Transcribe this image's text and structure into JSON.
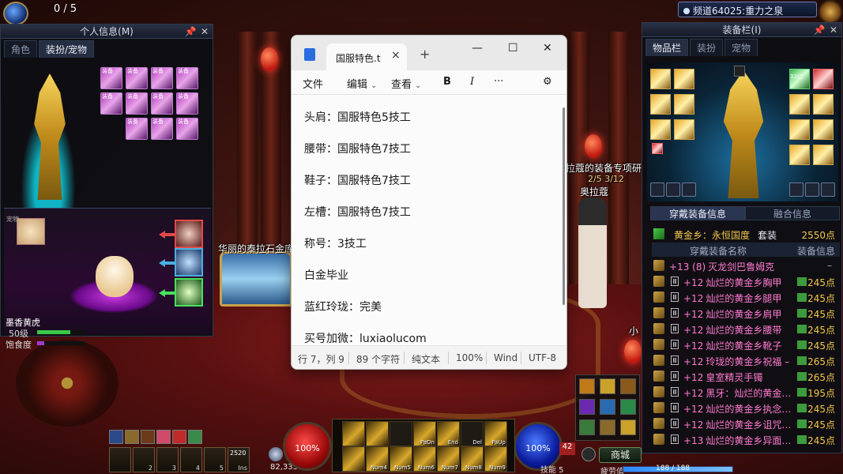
{
  "top_left": {
    "counter": "0 / 5"
  },
  "channel": {
    "label": "频道64025:重力之泉"
  },
  "scene": {
    "label_marble": "华丽的泰拉石金库",
    "label_shop": "拉蔻的装备专项研",
    "label_quest": "2/5 3/12",
    "label_npc": "奥拉蔻",
    "label_small": "小"
  },
  "left_panel": {
    "title": "个人信息(M)",
    "tabs": [
      "角色",
      "装扮/宠物"
    ],
    "slot_tag": "装备",
    "pet_thumb_label": "宠物",
    "pet_name": "墨香黄虎",
    "pet_level": "50级",
    "pet_satiety": "饱食度",
    "hp_fraction": 0.7,
    "sat_fraction": 0.15
  },
  "notepad": {
    "tab_title": "国服特色.t",
    "tab_close": "×",
    "new_tab": "+",
    "win_min": "—",
    "win_max": "☐",
    "win_close": "✕",
    "menu": {
      "file": "文件",
      "edit": "编辑",
      "view": "查看"
    },
    "lines": [
      "头肩：国服特色5技工",
      "腰带：国服特色7技工",
      "鞋子：国服特色7技工",
      "左槽：国服特色7技工",
      "称号：3技工",
      "白金毕业",
      "蓝红玲珑：完美",
      "买号加微：luxiaolucom"
    ],
    "status": {
      "position": "行 7，列 9",
      "chars": "89 个字符",
      "format": "纯文本",
      "zoom": "100%",
      "line_ending": "Wind",
      "encoding": "UTF-8"
    }
  },
  "right_panel": {
    "title": "装备栏(I)",
    "tabs": [
      "物品栏",
      "装扮",
      "宠物"
    ],
    "slot_badge": "33亿",
    "info_tabs": [
      "穿戴装备信息",
      "融合信息"
    ],
    "set_name": "黄金乡：永恒国度",
    "set_label": "套装",
    "set_points": "2550点",
    "col_name": "穿戴装备名称",
    "col_info": "装备信息",
    "col_info_dash": "–",
    "items": [
      {
        "plus": "+13 (8)",
        "name": "灭龙剑巴鲁姆克",
        "pts": "",
        "color": "#ff7ad0"
      },
      {
        "plus": "+12",
        "name": "灿烂的黄金乡胸甲",
        "pts": "245点",
        "color": "#ff7ad0"
      },
      {
        "plus": "+12",
        "name": "灿烂的黄金乡腿甲",
        "pts": "245点",
        "color": "#ff7ad0"
      },
      {
        "plus": "+12",
        "name": "灿烂的黄金乡肩甲",
        "pts": "245点",
        "color": "#ff7ad0"
      },
      {
        "plus": "+12",
        "name": "灿烂的黄金乡腰带",
        "pts": "245点",
        "color": "#ff7ad0"
      },
      {
        "plus": "+12",
        "name": "灿烂的黄金乡靴子",
        "pts": "245点",
        "color": "#ff7ad0"
      },
      {
        "plus": "+12",
        "name": "玲珑的黄金乡祝福 –",
        "pts": "265点",
        "color": "#ff7ad0"
      },
      {
        "plus": "+12",
        "name": "皇室精灵手镯",
        "pts": "265点",
        "color": "#ff7ad0"
      },
      {
        "plus": "+12",
        "name": "黑牙：灿烂的黄金…",
        "pts": "195点",
        "color": "#ff7ad0"
      },
      {
        "plus": "+12",
        "name": "灿烂的黄金乡执念…",
        "pts": "245点",
        "color": "#ff7ad0"
      },
      {
        "plus": "+12",
        "name": "灿烂的黄金乡诅咒…",
        "pts": "245点",
        "color": "#ff7ad0"
      },
      {
        "plus": "+13",
        "name": "灿烂的黄金乡异面…",
        "pts": "245点",
        "color": "#ff7ad0"
      }
    ]
  },
  "hud": {
    "gold": "82,335",
    "hp_percent": "100%",
    "mp_percent": "100%",
    "skill_caption": "技能  5",
    "level": "42",
    "store": "商城",
    "fatigue_label": "疲劳值",
    "fatigue_value": "188 / 188",
    "fatigue_fraction": 1.0,
    "quick_nums": [
      "",
      "2",
      "3",
      "4",
      "5",
      "Ins"
    ],
    "potion_label": "2520",
    "skill_row1": [
      "",
      "",
      "",
      "PaDn",
      "End",
      "Del",
      "PaUp"
    ],
    "skill_row2": [
      "",
      "Num4",
      "Num5",
      "Num6",
      "Num7",
      "Num8",
      "Num9"
    ]
  }
}
